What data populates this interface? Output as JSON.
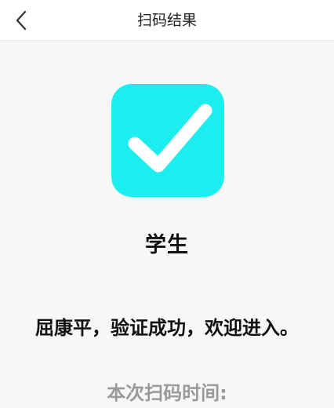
{
  "header": {
    "title": "扫码结果",
    "back_icon": "chevron-left-icon"
  },
  "result": {
    "icon": "checkmark-icon",
    "icon_color": "#1ceef0",
    "role": "学生",
    "message": "屈康平，验证成功，欢迎进入。",
    "scan_time_label": "本次扫码时间:"
  }
}
